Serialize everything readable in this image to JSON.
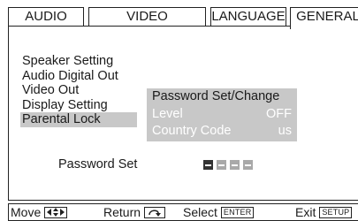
{
  "tabs": [
    {
      "label": "AUDIO"
    },
    {
      "label": "VIDEO"
    },
    {
      "label": "LANGUAGE"
    },
    {
      "label": "GENERAL"
    }
  ],
  "active_tab": "GENERAL",
  "menu": {
    "items": [
      {
        "label": "Speaker Setting"
      },
      {
        "label": "Audio Digital Out"
      },
      {
        "label": "Video Out"
      },
      {
        "label": "Display Setting"
      },
      {
        "label": "Parental Lock"
      }
    ],
    "selected": "Parental Lock"
  },
  "submenu": {
    "items": [
      {
        "label": "Password Set/Change",
        "value": ""
      },
      {
        "label": "Level",
        "value": "OFF"
      },
      {
        "label": "Country Code",
        "value": "us"
      }
    ]
  },
  "password": {
    "label": "Password Set",
    "digits": [
      "",
      "",
      "",
      ""
    ]
  },
  "bottom_bar": {
    "move_label": "Move",
    "return_label": "Return",
    "select_label": "Select",
    "select_key": "ENTER",
    "exit_label": "Exit",
    "exit_key": "SETUP"
  },
  "icons": {
    "move": "arrow-pad-icon",
    "return": "return-arrow-icon"
  }
}
